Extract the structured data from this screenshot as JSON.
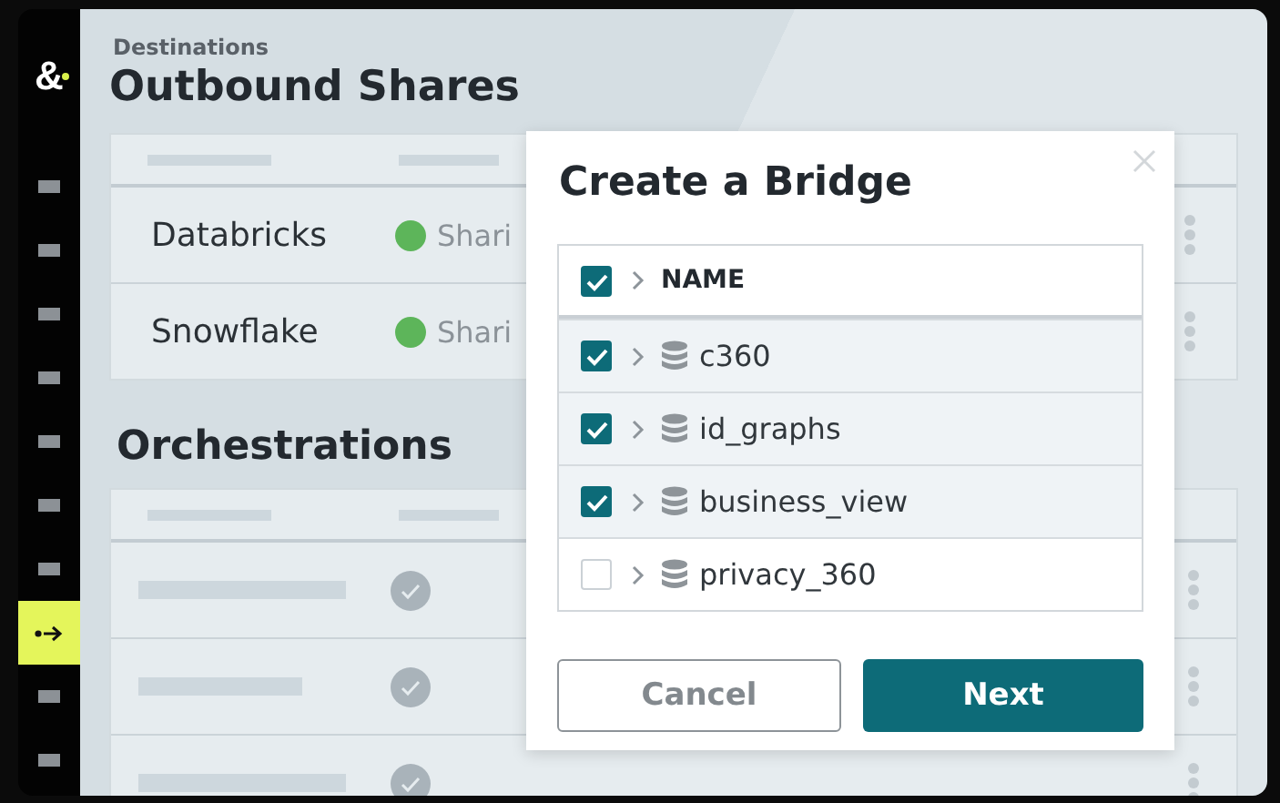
{
  "sidebar": {
    "logo": "&",
    "items": [
      {
        "kind": "placeholder",
        "selected": false
      },
      {
        "kind": "placeholder",
        "selected": false
      },
      {
        "kind": "placeholder",
        "selected": false
      },
      {
        "kind": "placeholder",
        "selected": false
      },
      {
        "kind": "placeholder",
        "selected": false
      },
      {
        "kind": "placeholder",
        "selected": false
      },
      {
        "kind": "placeholder",
        "selected": false
      },
      {
        "kind": "arrow",
        "selected": true
      },
      {
        "kind": "placeholder",
        "selected": false
      },
      {
        "kind": "placeholder",
        "selected": false
      }
    ]
  },
  "breadcrumb": "Destinations",
  "title": "Outbound Shares",
  "shares": [
    {
      "name": "Databricks",
      "status": "Shari"
    },
    {
      "name": "Snowflake",
      "status": "Shari"
    }
  ],
  "orchestrations": {
    "title": "Orchestrations"
  },
  "dialog": {
    "title": "Create a Bridge",
    "header": {
      "label": "NAME",
      "checked": true
    },
    "rows": [
      {
        "name": "c360",
        "checked": true
      },
      {
        "name": "id_graphs",
        "checked": true
      },
      {
        "name": "business_view",
        "checked": true
      },
      {
        "name": "privacy_360",
        "checked": false
      }
    ],
    "buttons": [
      {
        "label": "Cancel",
        "kind": "secondary"
      },
      {
        "label": "Next",
        "kind": "primary"
      }
    ]
  }
}
